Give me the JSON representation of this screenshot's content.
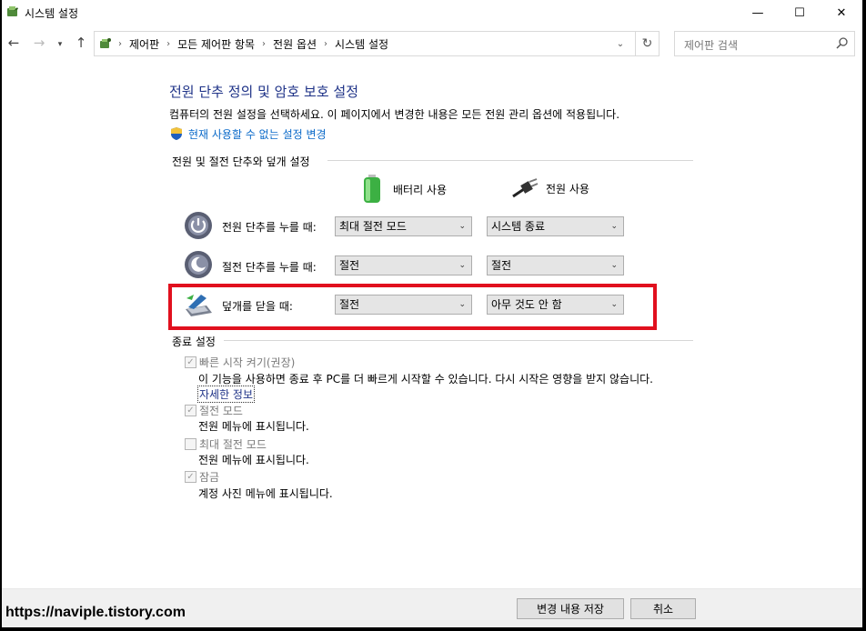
{
  "window": {
    "title": "시스템 설정"
  },
  "titlebar": {
    "minimize": "—",
    "maximize": "☐",
    "close": "✕"
  },
  "address": {
    "crumbs": [
      "제어판",
      "모든 제어판 항목",
      "전원 옵션",
      "시스템 설정"
    ],
    "search_placeholder": "제어판 검색"
  },
  "page": {
    "heading": "전원 단추 정의 및 암호 보호 설정",
    "description": "컴퓨터의 전원 설정을 선택하세요. 이 페이지에서 변경한 내용은 모든 전원 관리 옵션에 적용됩니다.",
    "admin_link": "현재 사용할 수 없는 설정 변경"
  },
  "buttons_section": {
    "label": "전원 및 절전 단추와 덮개 설정",
    "col_battery": "배터리 사용",
    "col_plugged": "전원 사용",
    "rows": [
      {
        "label": "전원 단추를 누를 때:",
        "battery": "최대 절전 모드",
        "plugged": "시스템 종료",
        "icon": "power-button-icon"
      },
      {
        "label": "절전 단추를 누를 때:",
        "battery": "절전",
        "plugged": "절전",
        "icon": "sleep-button-icon"
      },
      {
        "label": "덮개를 닫을 때:",
        "battery": "절전",
        "plugged": "아무 것도 안 함",
        "icon": "laptop-lid-icon"
      }
    ]
  },
  "shutdown_section": {
    "label": "종료 설정",
    "items": [
      {
        "label": "빠른 시작 켜기(권장)",
        "checked": true,
        "desc": "이 기능을 사용하면 종료 후 PC를 더 빠르게 시작할 수 있습니다. 다시 시작은 영향을 받지 않습니다.",
        "link": "자세한 정보"
      },
      {
        "label": "절전 모드",
        "checked": true,
        "desc": "전원 메뉴에 표시됩니다."
      },
      {
        "label": "최대 절전 모드",
        "checked": false,
        "desc": "전원 메뉴에 표시됩니다."
      },
      {
        "label": "잠금",
        "checked": true,
        "desc": "계정 사진 메뉴에 표시됩니다."
      }
    ]
  },
  "footer": {
    "watermark": "https://naviple.tistory.com",
    "save": "변경 내용 저장",
    "cancel": "취소"
  },
  "colors": {
    "heading": "#1e3287",
    "link": "#0b6ac9",
    "highlight": "#e1101e"
  }
}
